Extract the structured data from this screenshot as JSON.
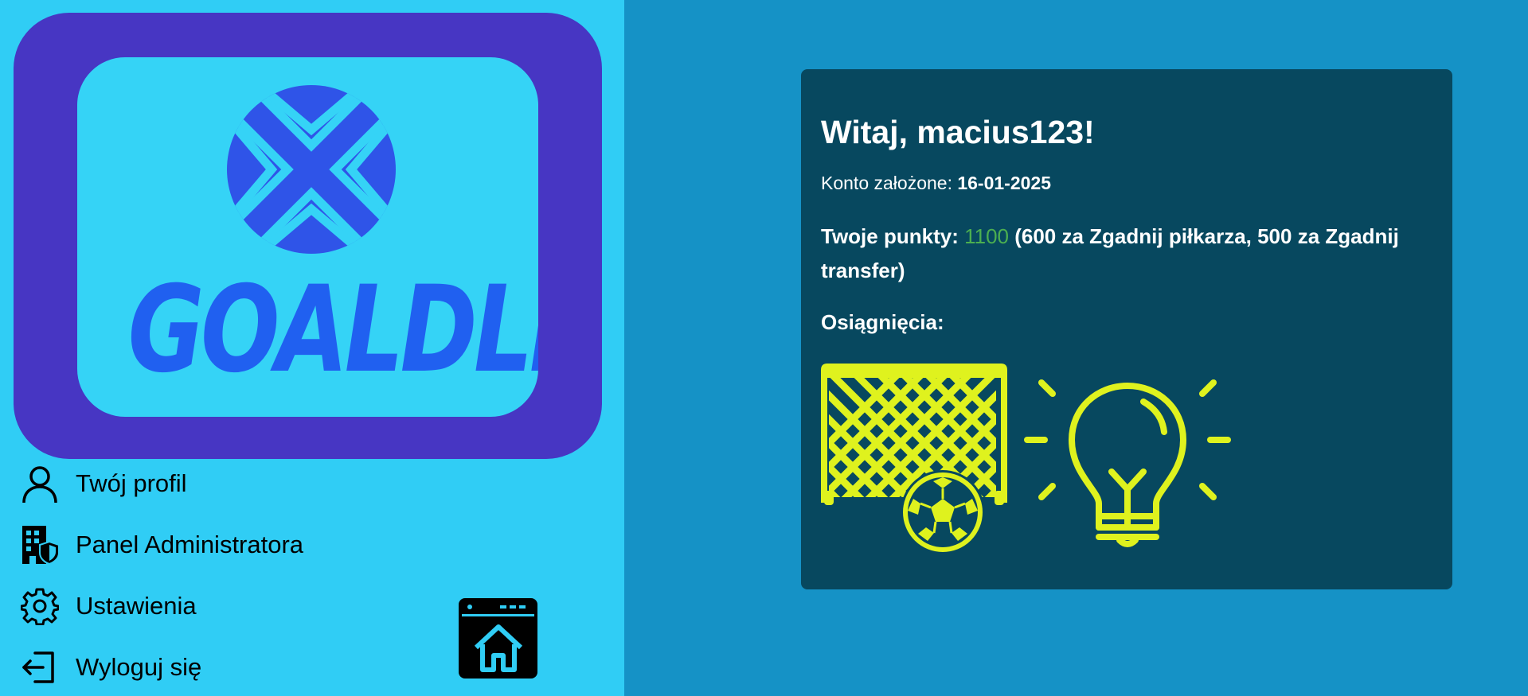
{
  "app": {
    "logo_text": "GOALDLE"
  },
  "sidebar": {
    "items": [
      {
        "label": "Twój profil",
        "icon": "user-icon"
      },
      {
        "label": "Panel Administratora",
        "icon": "building-shield-icon"
      },
      {
        "label": "Ustawienia",
        "icon": "gear-icon"
      },
      {
        "label": "Wyloguj się",
        "icon": "logout-icon"
      }
    ],
    "home_icon": "home-browser-icon"
  },
  "profile": {
    "greeting": "Witaj, macius123!",
    "account_label": "Konto założone: ",
    "account_date": "16-01-2025",
    "points_label": "Twoje punkty: ",
    "points_value": "1100",
    "points_detail": " (600 za Zgadnij piłkarza, 500 za Zgadnij transfer)",
    "achievements_label": "Osiągnięcia:",
    "achievements": [
      {
        "icon": "soccer-goal-icon"
      },
      {
        "icon": "lightbulb-icon"
      }
    ]
  },
  "colors": {
    "sidebar_bg": "#30cdf5",
    "main_bg": "#1592c6",
    "logo_frame": "#4736c3",
    "card_bg": "#07485f",
    "points_accent": "#4caf50",
    "badge_color": "#dff21e"
  }
}
